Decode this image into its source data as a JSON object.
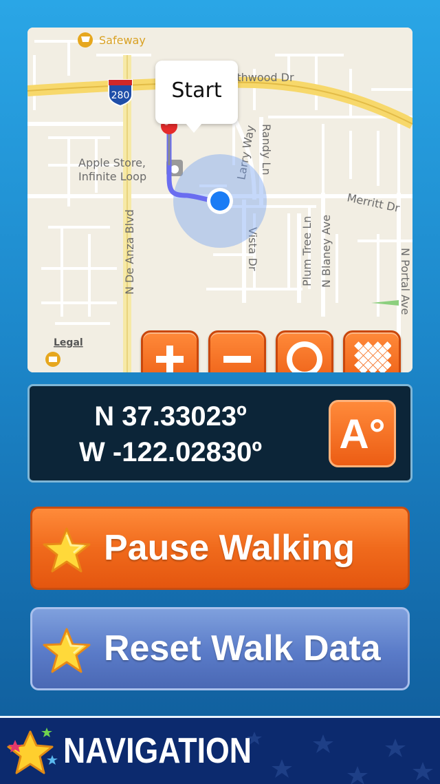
{
  "map": {
    "callout_label": "Start",
    "labels": {
      "safeway": "Safeway",
      "northwood": "Northwood Dr",
      "interstate": "280",
      "apple_store_1": "Apple Store,",
      "apple_store_2": "Infinite Loop",
      "larry_way": "Larry Way",
      "randy_ln": "Randy Ln",
      "merritt_dr": "Merritt Dr",
      "de_anza": "N De Anza Blvd",
      "vista_dr": "Vista Dr",
      "plum_tree": "Plum Tree Ln",
      "blaney": "N Blaney Ave",
      "portal": "N Portal Ave",
      "legal": "Legal"
    },
    "buttons": {
      "zoom_in_icon": "plus-icon",
      "zoom_out_icon": "minus-icon",
      "center_icon": "circle-icon",
      "map_type_icon": "grid-icon"
    }
  },
  "coordinates": {
    "latitude": "N 37.33023º",
    "longitude": "W -122.02830º",
    "format_button": "A°"
  },
  "actions": {
    "pause_label": "Pause Walking",
    "reset_label": "Reset Walk Data"
  },
  "nav": {
    "title": "NAVIGATION"
  },
  "colors": {
    "accent_orange": "#f06a1c",
    "accent_blue": "#5a7bc8",
    "panel_dark": "#0c2538",
    "user_location": "#1a7cf5",
    "route": "#6a6df0"
  }
}
